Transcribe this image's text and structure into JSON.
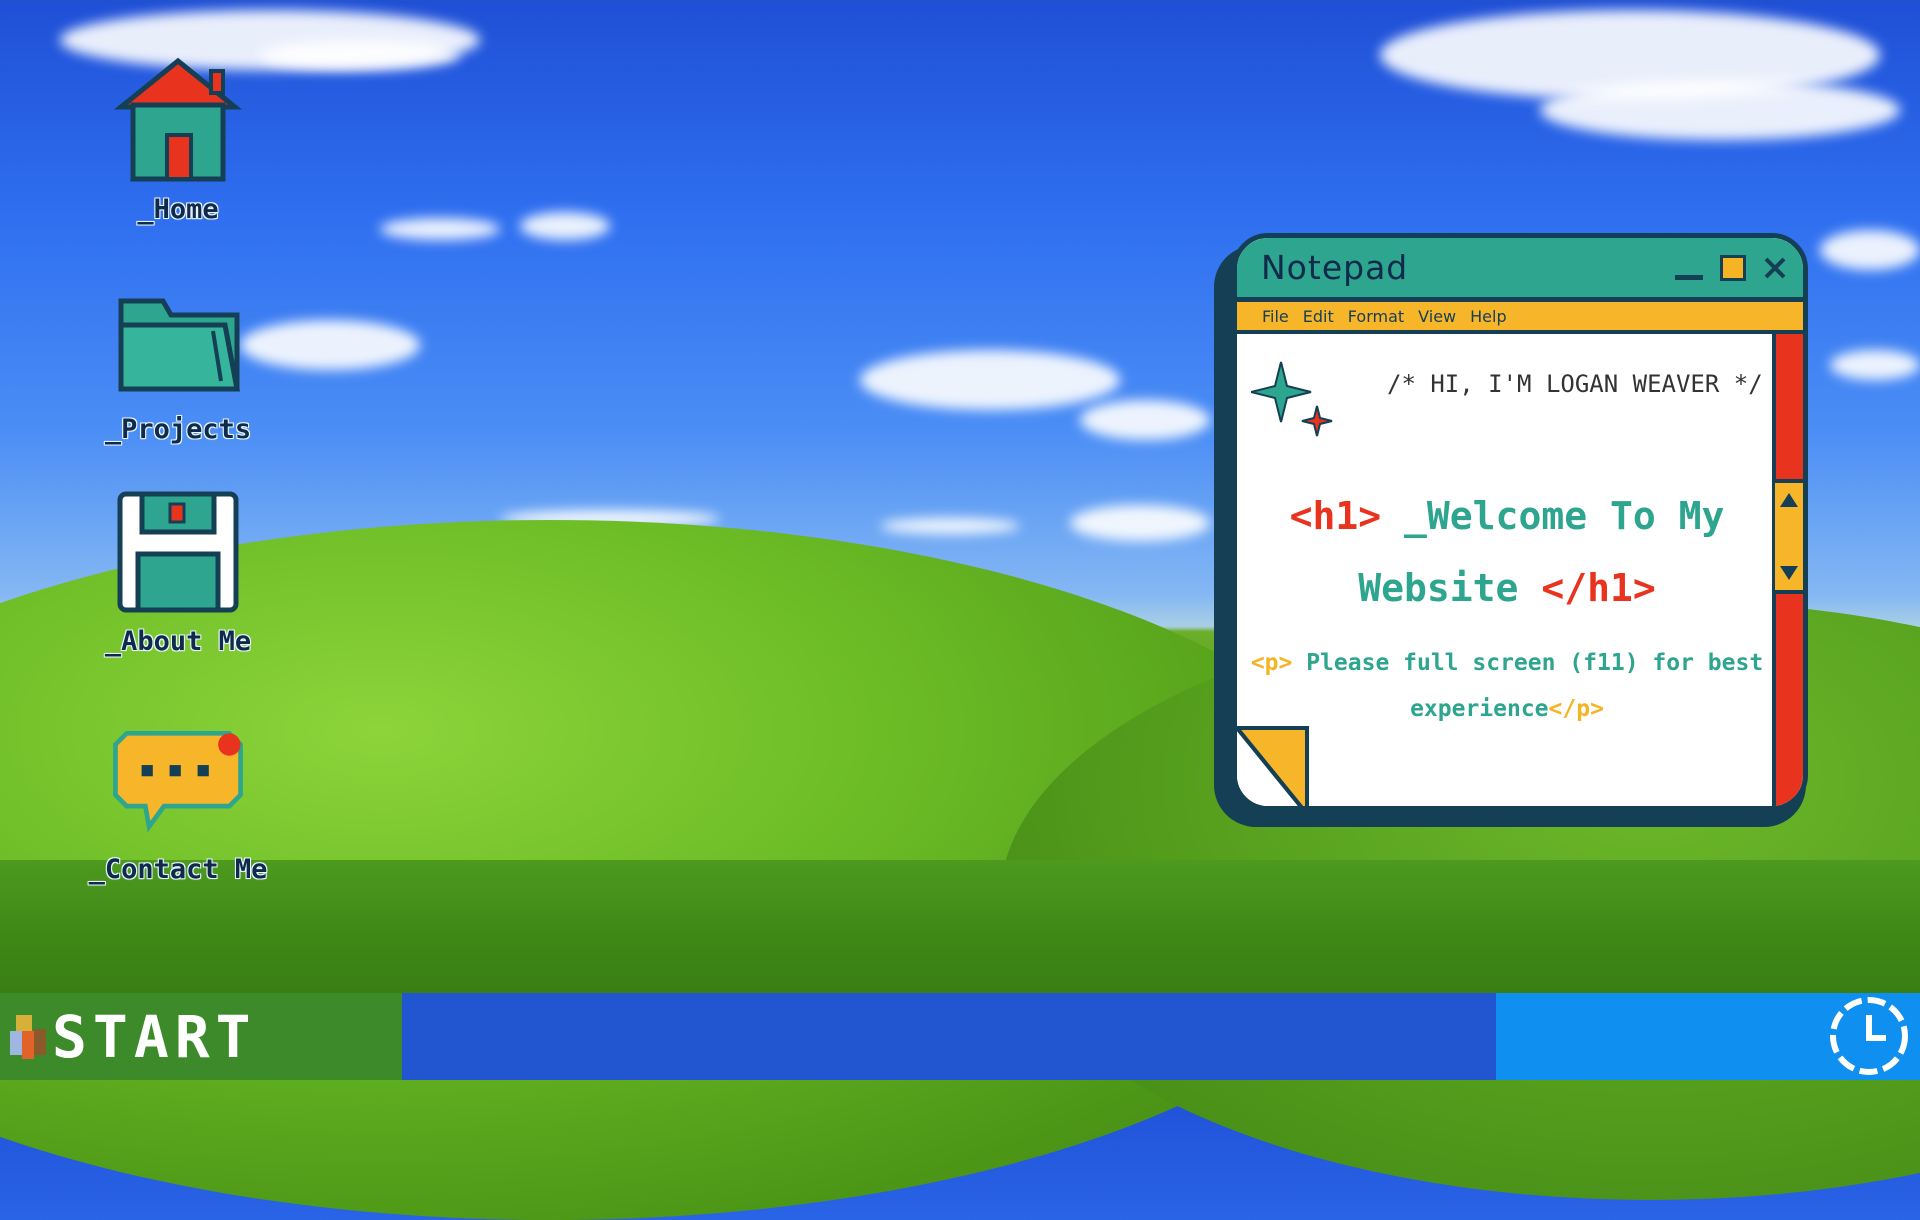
{
  "desktop": {
    "icons": [
      {
        "label": "_Home",
        "icon": "house-icon"
      },
      {
        "label": "_Projects",
        "icon": "folder-icon"
      },
      {
        "label": "_About Me",
        "icon": "floppy-disk-icon"
      },
      {
        "label": "_Contact Me",
        "icon": "chat-bubble-icon"
      }
    ]
  },
  "notepad": {
    "title": "Notepad",
    "menu": [
      "File",
      "Edit",
      "Format",
      "View",
      "Help"
    ],
    "comment": "/* HI, I'M LOGAN WEAVER */",
    "heading": {
      "open_tag": "<h1>",
      "text_line1": " _Welcome To My",
      "text_line2": "Website ",
      "close_tag": "</h1>"
    },
    "paragraph": {
      "open_tag": "<p>",
      "text_line1": " Please full screen (f11) for best",
      "text_line2": "experience",
      "close_tag": "</p>"
    }
  },
  "taskbar": {
    "start_label": "START",
    "clock_icon": "clock-icon"
  },
  "colors": {
    "teal": "#2ea58e",
    "navy": "#143f55",
    "yellow": "#f7b52a",
    "red": "#e8331f",
    "taskbar_blue": "#2255d0",
    "tray_blue": "#0f8ff0",
    "start_green": "#3c8a2a"
  }
}
